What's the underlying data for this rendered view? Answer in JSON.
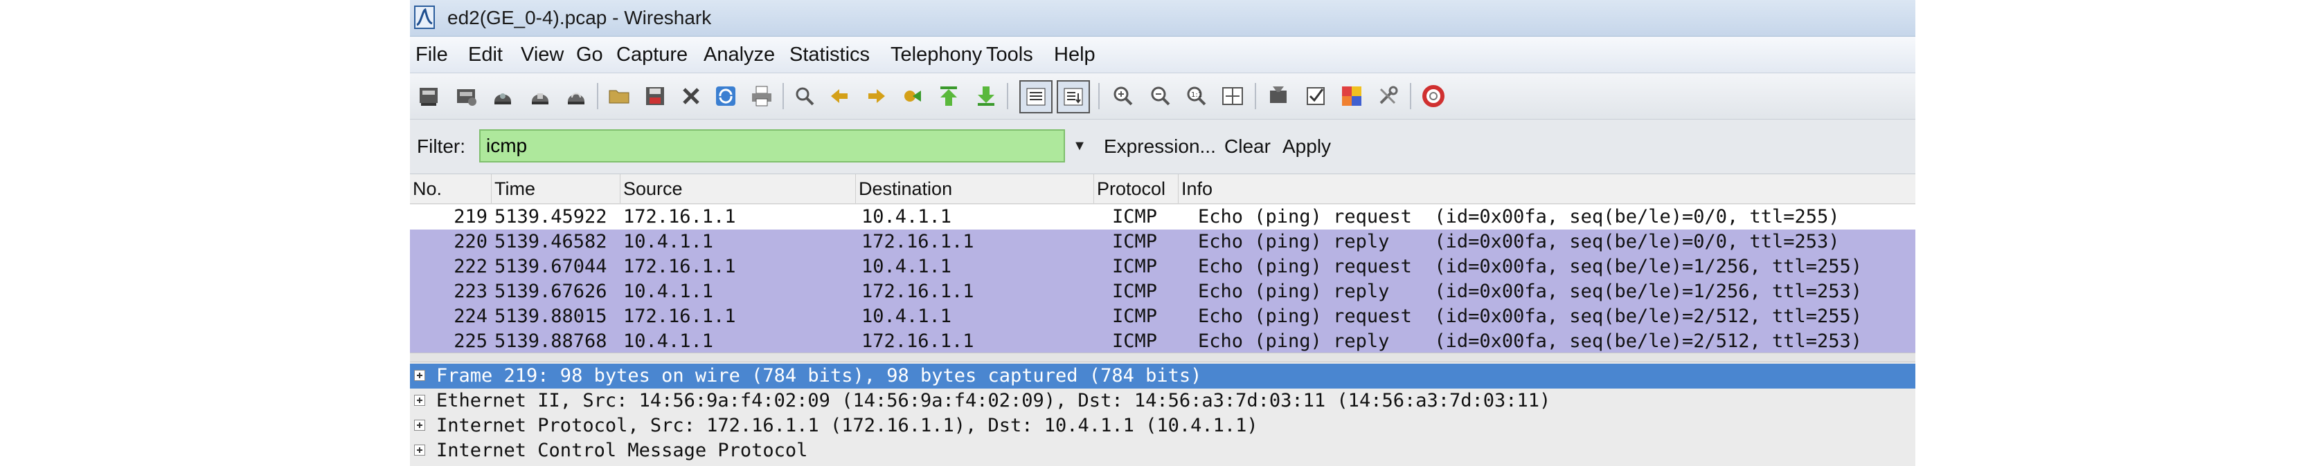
{
  "window": {
    "title": "ed2(GE_0-4).pcap - Wireshark"
  },
  "menu": [
    "File",
    "Edit",
    "View",
    "Go",
    "Capture",
    "Analyze",
    "Statistics",
    "Telephony",
    "Tools",
    "Help"
  ],
  "toolbar": {
    "icons": [
      "interfaces-icon",
      "options-icon",
      "start-capture-icon",
      "stop-capture-icon",
      "restart-capture-icon",
      "open-icon",
      "save-icon",
      "close-file-icon",
      "reload-icon",
      "print-icon",
      "find-icon",
      "back-icon",
      "forward-icon",
      "goto-packet-icon",
      "first-packet-icon",
      "last-packet-icon",
      "colorize-icon",
      "autoscroll-icon",
      "zoom-in-icon",
      "zoom-out-icon",
      "normal-size-icon",
      "resize-columns-icon",
      "capture-filters-icon",
      "display-filters-icon",
      "coloring-rules-icon",
      "preferences-icon",
      "help-icon"
    ]
  },
  "filter": {
    "label": "Filter:",
    "value": "icmp",
    "expression": "Expression...",
    "clear": "Clear",
    "apply": "Apply"
  },
  "columns": [
    "No.",
    "Time",
    "Source",
    "Destination",
    "Protocol",
    "Info"
  ],
  "packets": [
    {
      "no": "219",
      "time": "5139.45922",
      "source": "172.16.1.1",
      "destination": "10.4.1.1",
      "protocol": "ICMP",
      "info": "Echo (ping) request  (id=0x00fa, seq(be/le)=0/0, ttl=255)"
    },
    {
      "no": "220",
      "time": "5139.46582",
      "source": "10.4.1.1",
      "destination": "172.16.1.1",
      "protocol": "ICMP",
      "info": "Echo (ping) reply    (id=0x00fa, seq(be/le)=0/0, ttl=253)"
    },
    {
      "no": "222",
      "time": "5139.67044",
      "source": "172.16.1.1",
      "destination": "10.4.1.1",
      "protocol": "ICMP",
      "info": "Echo (ping) request  (id=0x00fa, seq(be/le)=1/256, ttl=255)"
    },
    {
      "no": "223",
      "time": "5139.67626",
      "source": "10.4.1.1",
      "destination": "172.16.1.1",
      "protocol": "ICMP",
      "info": "Echo (ping) reply    (id=0x00fa, seq(be/le)=1/256, ttl=253)"
    },
    {
      "no": "224",
      "time": "5139.88015",
      "source": "172.16.1.1",
      "destination": "10.4.1.1",
      "protocol": "ICMP",
      "info": "Echo (ping) request  (id=0x00fa, seq(be/le)=2/512, ttl=255)"
    },
    {
      "no": "225",
      "time": "5139.88768",
      "source": "10.4.1.1",
      "destination": "172.16.1.1",
      "protocol": "ICMP",
      "info": "Echo (ping) reply    (id=0x00fa, seq(be/le)=2/512, ttl=253)"
    }
  ],
  "details": [
    "Frame 219: 98 bytes on wire (784 bits), 98 bytes captured (784 bits)",
    "Ethernet II, Src: 14:56:9a:f4:02:09 (14:56:9a:f4:02:09), Dst: 14:56:a3:7d:03:11 (14:56:a3:7d:03:11)",
    "Internet Protocol, Src: 172.16.1.1 (172.16.1.1), Dst: 10.4.1.1 (10.4.1.1)",
    "Internet Control Message Protocol"
  ],
  "colors": {
    "row_selected": "#b7b3e3",
    "detail_highlight": "#4a86d0",
    "filter_bg": "#aee89c"
  }
}
